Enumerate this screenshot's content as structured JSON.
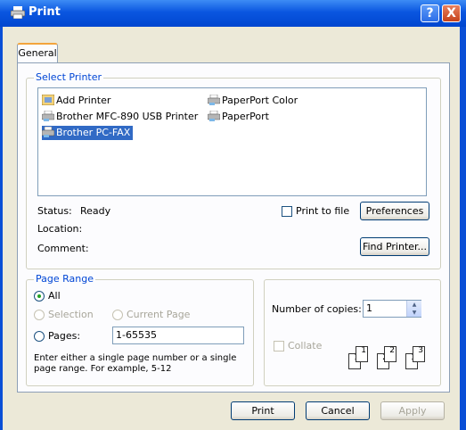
{
  "window": {
    "title": "Print",
    "help_label": "?",
    "close_label": "X"
  },
  "tabs": [
    {
      "label": "General"
    }
  ],
  "select_printer": {
    "legend": "Select Printer",
    "printers": [
      {
        "label": "Add Printer",
        "icon": "add-printer-icon"
      },
      {
        "label": "Brother MFC-890 USB Printer",
        "icon": "printer-icon"
      },
      {
        "label": "Brother PC-FAX",
        "icon": "fax-printer-icon",
        "selected": true
      },
      {
        "label": "PaperPort Color",
        "icon": "printer-icon"
      },
      {
        "label": "PaperPort",
        "icon": "printer-icon"
      }
    ],
    "status_label": "Status:",
    "status_value": "Ready",
    "location_label": "Location:",
    "comment_label": "Comment:",
    "print_to_file_label": "Print to file",
    "print_to_file_checked": false,
    "preferences_label": "Preferences",
    "find_printer_label": "Find Printer..."
  },
  "page_range": {
    "legend": "Page Range",
    "all_label": "All",
    "selection_label": "Selection",
    "current_page_label": "Current Page",
    "pages_label": "Pages:",
    "pages_value": "1-65535",
    "selected_option": "All",
    "hint": "Enter either a single page number or a single page range.  For example, 5-12"
  },
  "copies": {
    "label": "Number of copies:",
    "value": "1",
    "collate_label": "Collate",
    "collate_checked": false,
    "collate_enabled": false
  },
  "buttons": {
    "print": "Print",
    "cancel": "Cancel",
    "apply": "Apply"
  },
  "colors": {
    "titlebar": "#0a56e0",
    "selection": "#316ac5",
    "group_legend": "#0046d5",
    "dialog_bg": "#ece9d8"
  }
}
